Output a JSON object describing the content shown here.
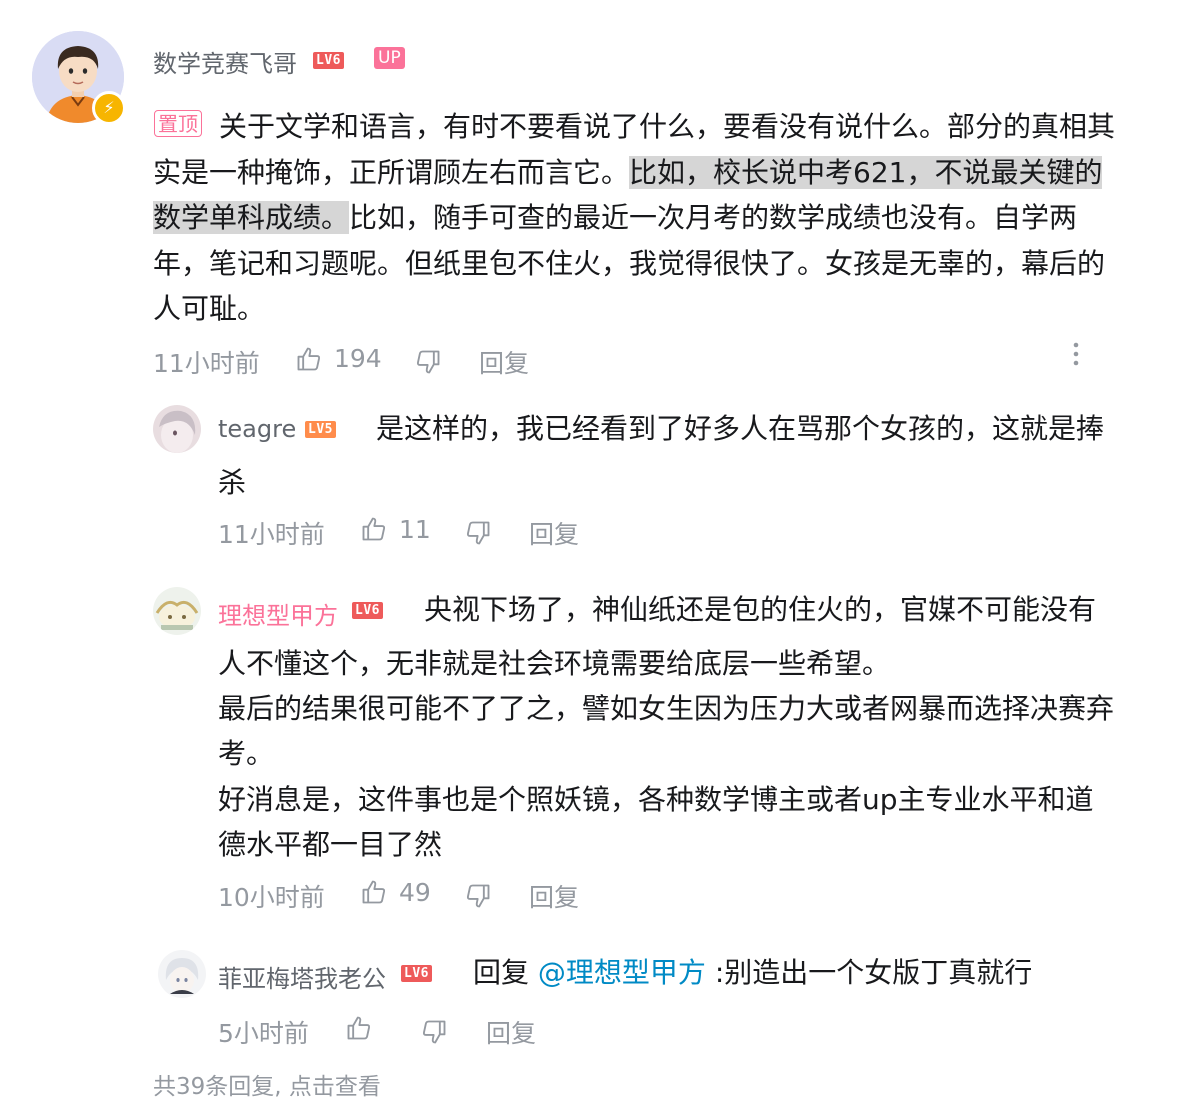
{
  "main_comment": {
    "username": "数学竞赛飞哥",
    "level": "LV6",
    "up_badge": "UP",
    "pin_label": "置顶",
    "text_lines": [
      "关于文学和语言，有时不要看说了什么，要看没有说什么。部分的真相其",
      "实是一种掩饰，正所谓顾左右而言它。",
      "比如，校长说中考621，不说最关键的",
      "数学单科成绩。",
      "比如，随手可查的最近一次月考的数学成绩也没有。自学两",
      "年，笔记和习题呢。但纸里包不住火，我觉得很快了。女孩是无辜的，幕后的",
      "人可耻。"
    ],
    "time": "11小时前",
    "likes": "194",
    "reply_label": "回复",
    "more_icon": "more-vertical-icon"
  },
  "replies": [
    {
      "username": "teagre",
      "level": "LV5",
      "text_line1": "是这样的，我已经看到了好多人在骂那个女孩的，这就是捧",
      "text_line2": "杀",
      "time": "11小时前",
      "likes": "11",
      "reply_label": "回复"
    },
    {
      "username": "理想型甲方",
      "level": "LV6",
      "text_line1": "央视下场了，神仙纸还是包的住火的，官媒不可能没有",
      "text_lines": [
        "人不懂这个，无非就是社会环境需要给底层一些希望。",
        "最后的结果很可能不了了之，譬如女生因为压力大或者网暴而选择决赛弃",
        "考。",
        "好消息是，这件事也是个照妖镜，各种数学博主或者up主专业水平和道",
        "德水平都一目了然"
      ],
      "time": "10小时前",
      "likes": "49",
      "reply_label": "回复"
    },
    {
      "username": "菲亚梅塔我老公",
      "level": "LV6",
      "reply_prefix": "回复",
      "mention": "@理想型甲方",
      "text": ":别造出一个女版丁真就行",
      "time": "5小时前",
      "reply_label": "回复"
    }
  ],
  "footer": {
    "view_more": "共39条回复, 点击查看"
  },
  "colors": {
    "pink": "#fb7299",
    "gray_text": "#9499a0",
    "level_red": "#ee5a5a",
    "level_orange": "#ff8c4b",
    "mention_blue": "#008ac5",
    "highlight": "#d6d6d6"
  }
}
